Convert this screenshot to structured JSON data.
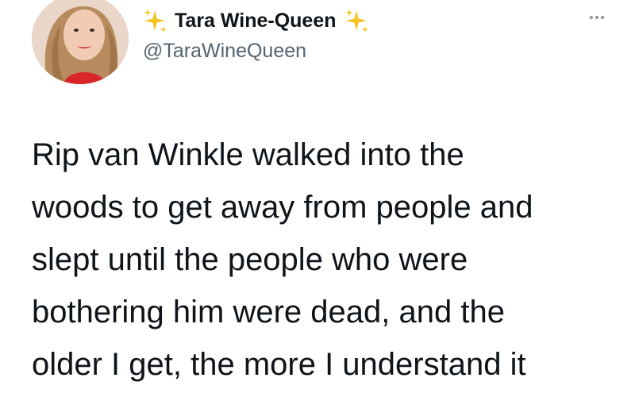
{
  "author": {
    "display_name": "Tara Wine-Queen",
    "handle": "@TaraWineQueen",
    "avatar_icon": "profile-photo",
    "name_decoration_icon": "sparkles-icon",
    "sparkle_color": "#f4b400"
  },
  "menu": {
    "icon": "more-options-icon"
  },
  "tweet": {
    "lines": [
      "Rip van Winkle walked into the",
      "woods to get away from people and",
      "slept until the people who were",
      "bothering him were dead, and the",
      "older I get, the more I understand it"
    ]
  }
}
